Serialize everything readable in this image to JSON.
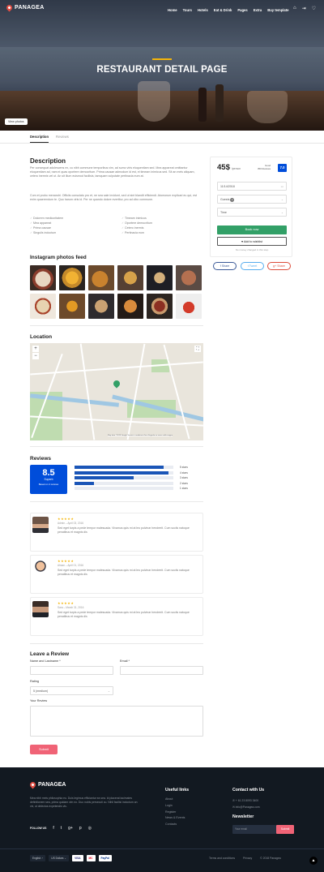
{
  "header": {
    "logo_text": "PANAGEA",
    "nav": [
      "Home",
      "Tours",
      "Hotels",
      "Eat & Drink",
      "Pages",
      "Extra",
      "Buy template"
    ],
    "icons": [
      "cart-icon",
      "login-icon",
      "heart-icon"
    ]
  },
  "hero": {
    "title": "RESTAURANT DETAIL PAGE",
    "gallery_button": "View photos"
  },
  "tabs": {
    "description": "Description",
    "reviews": "Reviews"
  },
  "description": {
    "heading": "Description",
    "para1": "Per consequat adolescens ex, cu nibh commune temporibus vim, ad sumo viris eloquentiam sed. Mea appareat omittantur eloquentiam ad, nam ei quas oportere democritum. Prima causae admodum id est, ei timeam inimicus sed. Sit an meis aliquam, cetero inermis vel ut. An sit illum euismod facilisis, tamquam vulputate pertinacia eum at.",
    "para2": "Cum et probo menandri. Officiis consulatu pro et, ne sea sale invidunt, sed ut sint blandit efficiendi. Atomorum explicari eu qui, est enim quaerendum te. Quo harum viris id. Per ne quando dolore evertitur, pro ad cibo commune.",
    "bullets_left": [
      "Dolorem mediocritatem",
      "Mea appareat",
      "Prima causae",
      "Singulis indoctum"
    ],
    "bullets_right": [
      "Timeam inimicus",
      "Oportere democritum",
      "Cetero inermis",
      "Pertinacia eum"
    ]
  },
  "instagram": {
    "heading": "Instagram photos feed"
  },
  "location": {
    "heading": "Location",
    "map_attribution": "Map data ©2018 Google   Termini e condizioni d'uso   Segnala un errore nella mappa",
    "zoom_in": "+",
    "zoom_out": "−",
    "fullscreen": "⛶"
  },
  "reviews": {
    "heading": "Reviews",
    "score": "8.5",
    "score_label": "Superb",
    "score_sub": "Based on 4 reviews",
    "bars": [
      {
        "label": "5 stars",
        "fraction": 0.9
      },
      {
        "label": "4 stars",
        "fraction": 0.95
      },
      {
        "label": "3 stars",
        "fraction": 0.6
      },
      {
        "label": "2 stars",
        "fraction": 0.2
      },
      {
        "label": "1 stars",
        "fraction": 0.0
      }
    ],
    "items": [
      {
        "stars": "★★★★★",
        "who": "Admin – April 03, 2016",
        "text": "Sed eget turpis a pede tempor malesuada. Vivamus quis mi at leo pulvinar hendrerit. Cum sociis natoque penatibus et magnis dis"
      },
      {
        "stars": "★★★★★",
        "who": "Ahsan – April 01, 2016",
        "text": "Sed eget turpis a pede tempor malesuada. Vivamus quis mi at leo pulvinar hendrerit. Cum sociis natoque penatibus et magnis dis"
      },
      {
        "stars": "★★★★★",
        "who": "Sara – March 31, 2016",
        "text": "Sed eget turpis a pede tempor malesuada. Vivamus quis mi at leo pulvinar hendrerit. Cum sociis natoque penatibus et magnis dis"
      }
    ]
  },
  "leave_review": {
    "heading": "Leave a Review",
    "name_label": "Name and Lastname *",
    "email_label": "Email *",
    "rating_label": "Rating",
    "rating_value": "5 (medium)",
    "review_label": "Your Review",
    "submit": "Submit"
  },
  "booking": {
    "price": "45$",
    "price_unit": "/person",
    "rating_label": "Good",
    "rating_sub": "350 Reviews",
    "rating_score": "7.0",
    "date": "11/14/2018",
    "guests": "Guests",
    "guests_count": "1",
    "time": "Time",
    "book_now": "Book now",
    "wishlist": "Add to wishlist",
    "no_money": "No money charged in this step"
  },
  "share": {
    "facebook": "Share",
    "twitter": "Tweet",
    "google": "Share"
  },
  "footer": {
    "logo_text": "PANAGEA",
    "about": "Mea nibh meis philosophia eu. Duis legimus efficiantur ea sea. Id placerat tacimates definitionem sea, prima quidam vim no. Duo nobis persecuti cu. Nihil facilisi indoctum an vix, ut delectus expetendis vis.",
    "follow_us": "FOLLOW US",
    "useful_links_heading": "Useful links",
    "useful_links": [
      "About",
      "Login",
      "Register",
      "News & Events",
      "Contacts"
    ],
    "contact_heading": "Contact with Us",
    "phone": "+ 61 23 8093 3400",
    "email": "info@Panagea.com",
    "newsletter_heading": "Newsletter",
    "newsletter_placeholder": "Your email",
    "newsletter_submit": "Submit",
    "language": "English",
    "currency": "US Dollars",
    "payment_cards": [
      "VISA",
      "MC",
      "PayPal"
    ],
    "terms": "Terms and conditions",
    "privacy": "Privacy",
    "copyright": "© 2018 Panagea"
  },
  "colors": {
    "accent_blue": "#004dda",
    "book_green": "#32a067",
    "submit_pink": "#f06376",
    "star_yellow": "#f5b50a",
    "footer_bg": "#121921"
  }
}
